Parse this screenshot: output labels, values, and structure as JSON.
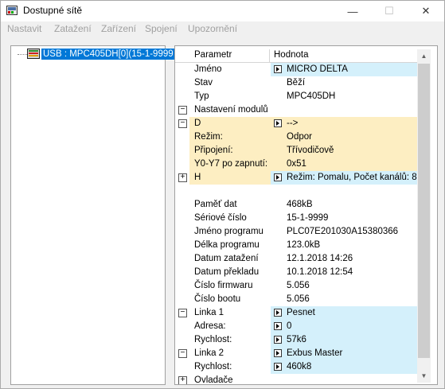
{
  "window": {
    "title": "Dostupné sítě",
    "minimize_glyph": "—",
    "maximize_glyph": "☐",
    "close_glyph": "✕"
  },
  "menu": [
    "Nastavit",
    "Zatažení",
    "Zařízení",
    "Spojení",
    "Upozornění"
  ],
  "tree": {
    "items": [
      {
        "label": "USB : MPC405DH[0](15-1-9999",
        "icon": "plc-device-icon",
        "selected": true
      }
    ]
  },
  "properties": {
    "header": {
      "param": "Parametr",
      "value": "Hodnota"
    },
    "rows": [
      {
        "name": "Jméno",
        "value": "MICRO DELTA",
        "button": true,
        "bg": "blue"
      },
      {
        "name": "Stav",
        "value": "Běží",
        "bg": "white"
      },
      {
        "name": "Typ",
        "value": "MPC405DH",
        "bg": "white"
      },
      {
        "name": "Nastavení modulů",
        "value": "",
        "expander": "−",
        "bg": "white",
        "span": true
      },
      {
        "name": "D",
        "value": "-->",
        "button": true,
        "expander": "−",
        "bg": "yellow"
      },
      {
        "name": "Režim:",
        "value": "Odpor",
        "bg": "yellow"
      },
      {
        "name": "Připojení:",
        "value": "Třívodičově",
        "bg": "yellow"
      },
      {
        "name": "Y0-Y7 po zapnutí:",
        "value": "0x51",
        "bg": "yellow"
      },
      {
        "name": "H",
        "value": "Režim:  Pomalu, Počet kanálů: 8",
        "button": true,
        "expander": "+",
        "bg": "yellow-blue"
      },
      {
        "name": "",
        "value": "",
        "bg": "white",
        "span": true
      },
      {
        "name": "Paměť dat",
        "value": "468kB",
        "bg": "white"
      },
      {
        "name": "Sériové číslo",
        "value": "15-1-9999",
        "bg": "white"
      },
      {
        "name": "Jméno programu",
        "value": "PLC07E201030A15380366",
        "bg": "white"
      },
      {
        "name": "Délka programu",
        "value": "123.0kB",
        "bg": "white"
      },
      {
        "name": "Datum zatažení",
        "value": "12.1.2018  14:26",
        "bg": "white"
      },
      {
        "name": "Datum překladu",
        "value": "10.1.2018  12:54",
        "bg": "white"
      },
      {
        "name": "Číslo firmwaru",
        "value": "5.056",
        "bg": "white"
      },
      {
        "name": "Číslo bootu",
        "value": "5.056",
        "bg": "white"
      },
      {
        "name": "Linka 1",
        "value": "Pesnet",
        "button": true,
        "expander": "−",
        "bg": "blue"
      },
      {
        "name": "Adresa:",
        "value": "0",
        "button": true,
        "bg": "blue"
      },
      {
        "name": "Rychlost:",
        "value": "57k6",
        "button": true,
        "bg": "blue"
      },
      {
        "name": "Linka 2",
        "value": "Exbus Master",
        "button": true,
        "expander": "−",
        "bg": "blue"
      },
      {
        "name": "Rychlost:",
        "value": "460k8",
        "button": true,
        "bg": "blue"
      },
      {
        "name": "Ovladače",
        "value": "",
        "expander": "+",
        "bg": "white"
      }
    ]
  },
  "colors": {
    "blue_row": "#d4f0fb",
    "yellow_row": "#fdeec2",
    "selection": "#0078d7"
  }
}
